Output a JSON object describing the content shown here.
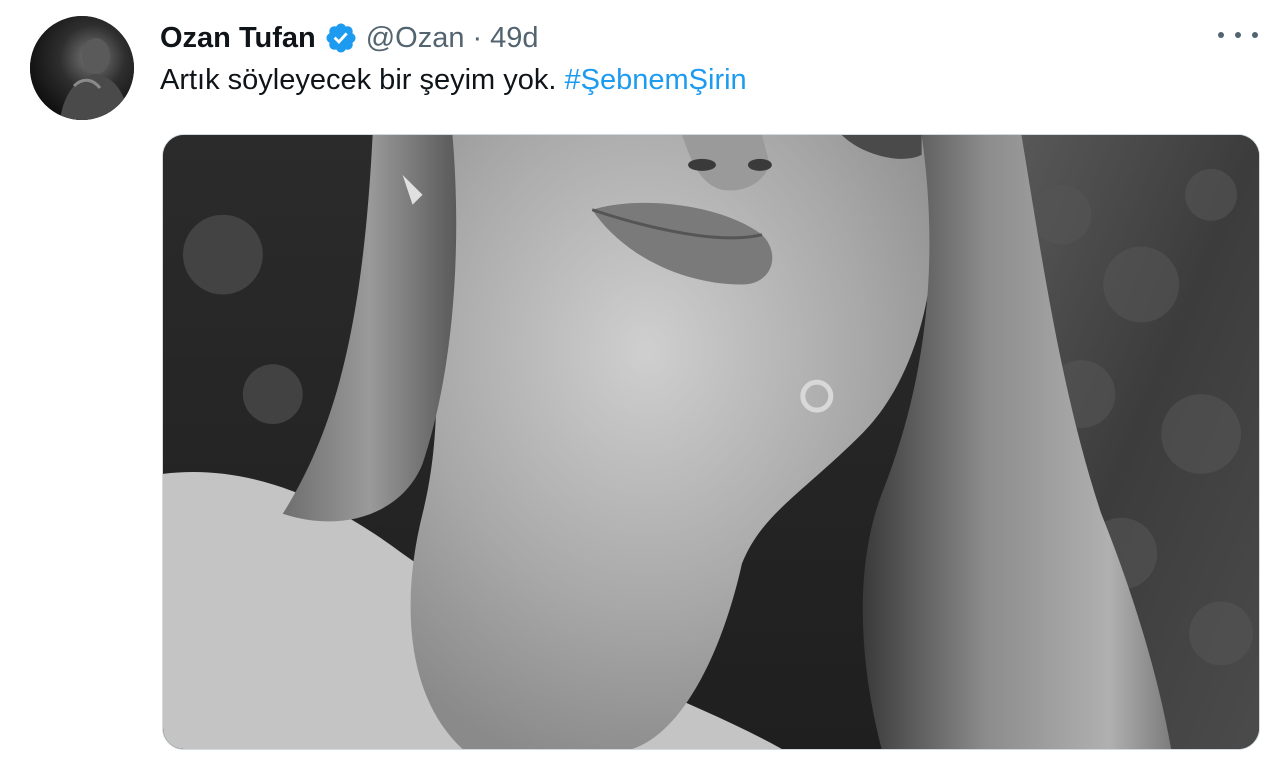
{
  "tweet": {
    "author_name": "Ozan Tufan",
    "handle": "@Ozan",
    "separator": "·",
    "time": "49d",
    "text_plain": "Artık söyleyecek bir şeyim yok.",
    "hashtag": "#ŞebnemŞirin",
    "verified": true,
    "avatar": "profile-photo",
    "media": "grayscale-photo-of-woman",
    "more_icon": "ellipsis-icon",
    "verified_icon": "verified-badge-icon"
  },
  "colors": {
    "text": "#0f1419",
    "secondary": "#536471",
    "link": "#1d9bf0",
    "verified": "#1d9bf0"
  }
}
